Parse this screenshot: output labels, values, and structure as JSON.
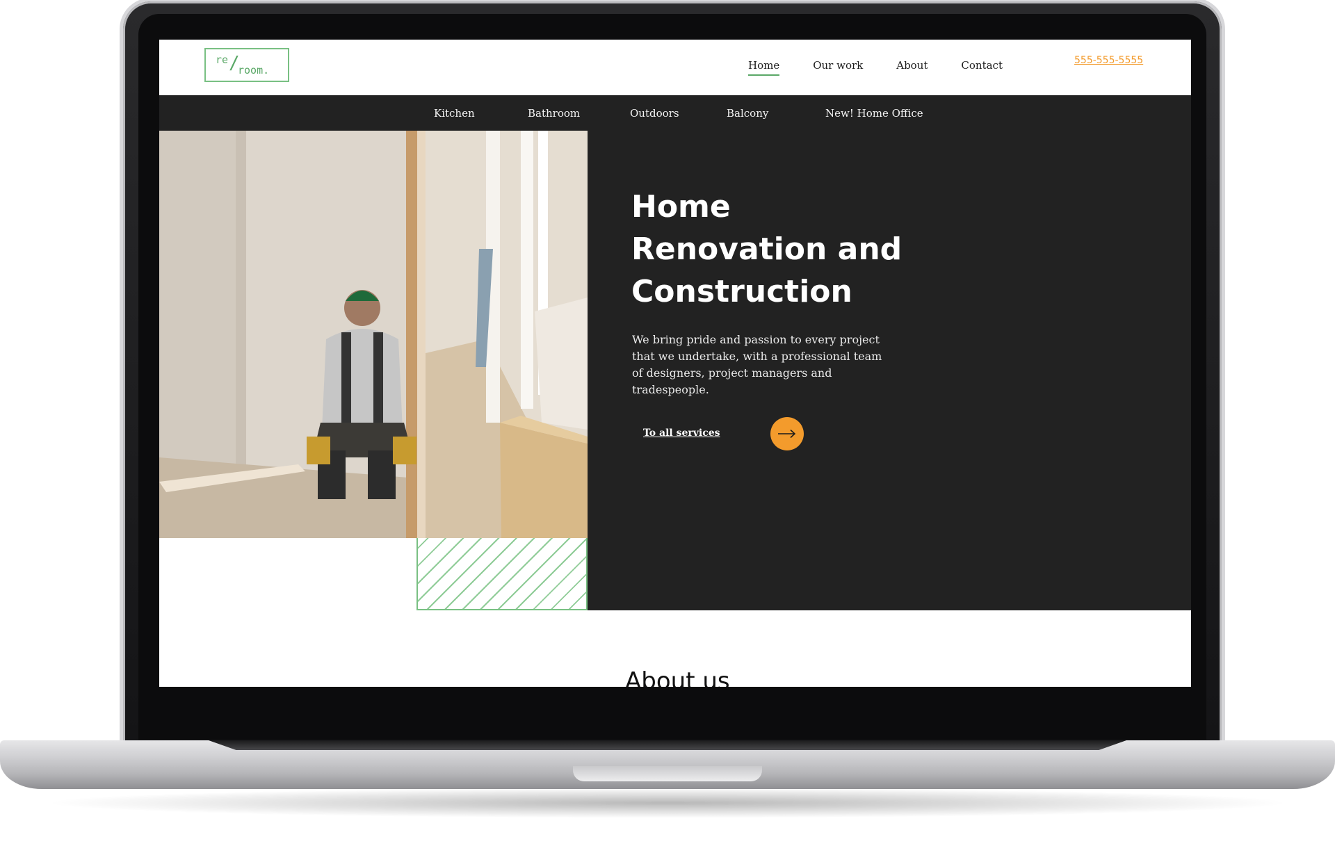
{
  "logo": {
    "line1": "re",
    "slash": "/",
    "line2": "room."
  },
  "nav": {
    "items": [
      {
        "label": "Home",
        "active": true
      },
      {
        "label": "Our work"
      },
      {
        "label": "About"
      },
      {
        "label": "Contact"
      }
    ],
    "phone": "555-555-5555"
  },
  "subnav": {
    "items": [
      "Kitchen",
      "Bathroom",
      "Outdoors",
      "Balcony",
      "New! Home Office"
    ]
  },
  "hero": {
    "title_lines": [
      "Home",
      "Renovation and",
      "Construction"
    ],
    "text": "We bring pride and passion to every project that we undertake, with a professional team of designers, project managers and tradespeople.",
    "cta_label": "To all services",
    "cta_icon": "arrow-right-icon",
    "image_icon": "construction-worker-photo"
  },
  "about": {
    "title": "About us"
  },
  "colors": {
    "accent_green": "#5aa867",
    "accent_orange": "#f39b2c",
    "dark_bg": "#222222"
  }
}
